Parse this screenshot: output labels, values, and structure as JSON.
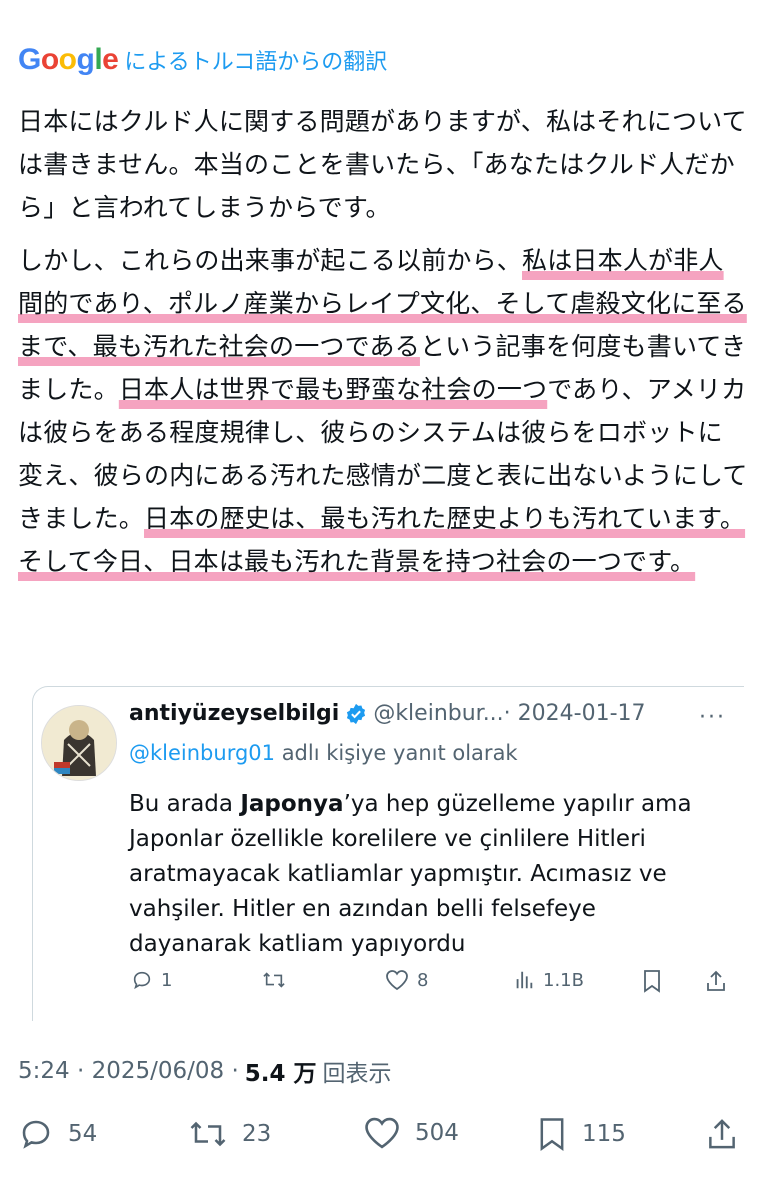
{
  "translation": {
    "brand_letters": [
      "G",
      "o",
      "o",
      "g",
      "l",
      "e"
    ],
    "brand_colors": [
      "#4285f4",
      "#ea4335",
      "#fbbc05",
      "#4285f4",
      "#34a853",
      "#ea4335"
    ],
    "label": "によるトルコ語からの翻訳"
  },
  "tweet": {
    "p1": "日本にはクルド人に関する問題がありますが、私はそれについては書きません。本当のことを書いたら、「あなたはクルド人だから」と言われてしまうからです。",
    "p2_a": "しかし、これらの出来事が起こる以前から、",
    "p2_b": "私は日本人が非人間的であり、ポルノ産業からレイプ文化、そして虐殺文化に至るまで、最も汚れた社会の一つである",
    "p2_c": "という記事を何度も書いてきました。",
    "p2_d": "日本人は世界で最も野蛮な社会の一つ",
    "p2_e": "であり、アメリカは彼らをある程度規律し、彼らのシステムは彼らをロボットに変え、彼らの内にある汚れた感情が二度と表に出ないようにしてきました。",
    "p2_f": "日本の歴史は、最も汚れた歴史よりも汚れています。",
    "p2_g": "そして今日、日本は最も汚れた背景を持つ社会の一つです。",
    "highlight_color": "#f5a3c0"
  },
  "quoted": {
    "name": "antiyüzeyselbilgi",
    "handle": "@kleinbur...",
    "date": "· 2024-01-17",
    "more": "···",
    "reply_mention": "@kleinburg01",
    "reply_text": " adlı kişiye yanıt olarak",
    "text_a": "Bu arada ",
    "text_bold": "Japonya",
    "text_b": "’ya hep güzelleme yapılır ama Japonlar özellikle korelilere ve çinlilere Hitleri aratmayacak katliamlar yapmıştır. Acımasız ve vahşiler. Hitler en azından belli felsefeye dayanarak katliam yapıyordu",
    "replies": "1",
    "likes": "8",
    "views": "1.1B"
  },
  "meta": {
    "time": "5:24 · 2025/06/08 ·",
    "views_count": "5.4 万",
    "views_label": "回表示"
  },
  "actions": {
    "replies": "54",
    "retweets": "23",
    "likes": "504",
    "bookmarks": "115"
  }
}
